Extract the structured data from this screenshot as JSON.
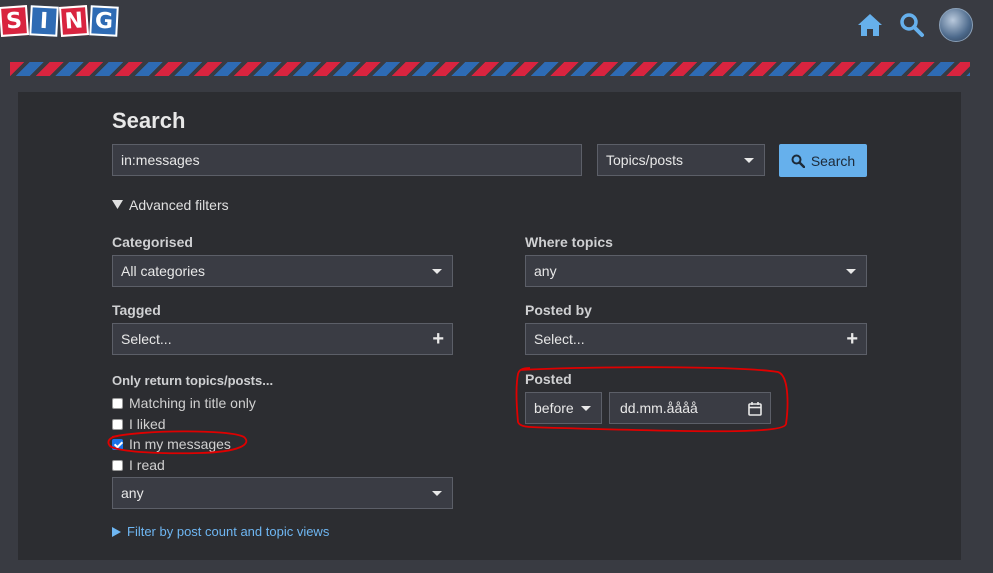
{
  "header": {
    "logo_letters": [
      "S",
      "I",
      "N",
      "G"
    ],
    "home_icon": "home-icon",
    "search_icon": "search-icon",
    "avatar": "avatar"
  },
  "search": {
    "title": "Search",
    "query": "in:messages",
    "type_selected": "Topics/posts",
    "button_label": "Search"
  },
  "advanced": {
    "toggle_label": "Advanced filters",
    "categorised": {
      "label": "Categorised",
      "value": "All categories"
    },
    "tagged": {
      "label": "Tagged",
      "value": "Select..."
    },
    "where_topics": {
      "label": "Where topics",
      "value": "any"
    },
    "posted_by": {
      "label": "Posted by",
      "value": "Select..."
    },
    "only_return": {
      "label": "Only return topics/posts...",
      "options": [
        {
          "label": "Matching in title only",
          "checked": false
        },
        {
          "label": "I liked",
          "checked": false
        },
        {
          "label": "In my messages",
          "checked": true
        },
        {
          "label": "I read",
          "checked": false
        }
      ],
      "select_value": "any"
    },
    "posted": {
      "label": "Posted",
      "when": "before",
      "date_placeholder": "dd.mm.åååå"
    },
    "more_link": "Filter by post count and topic views"
  },
  "colors": {
    "accent": "#66b0ec",
    "annotation": "#e00000",
    "stripe_red": "#d9243f",
    "stripe_blue": "#2e6bb4"
  }
}
